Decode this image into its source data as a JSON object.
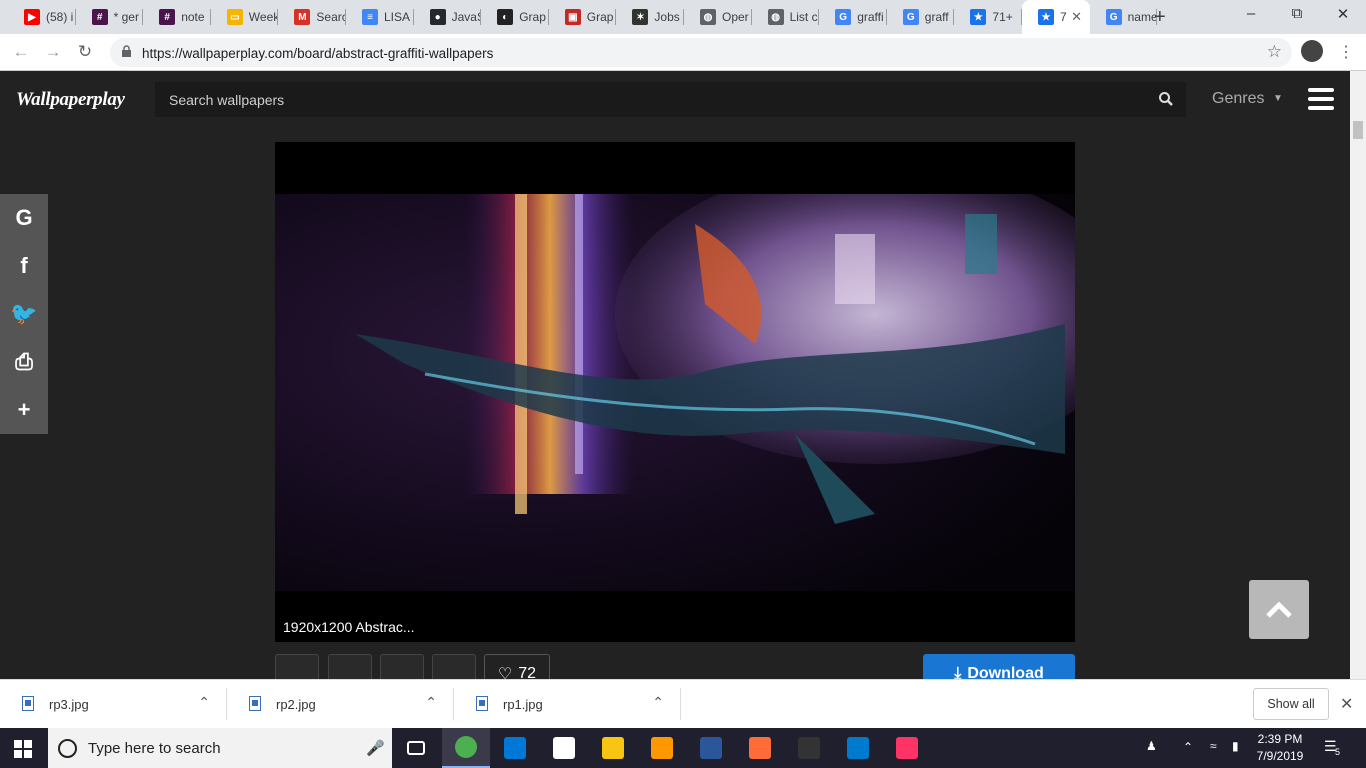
{
  "browser": {
    "tabs": [
      {
        "label": "(58) i",
        "icon": "youtube-icon",
        "color": "#ff0000",
        "glyph": "▶"
      },
      {
        "label": "* ger",
        "icon": "slack-icon",
        "color": "#4a154b",
        "glyph": "#"
      },
      {
        "label": "note",
        "icon": "slack-icon",
        "color": "#4a154b",
        "glyph": "#"
      },
      {
        "label": "Week",
        "icon": "google-slides-icon",
        "color": "#f4b400",
        "glyph": "▭"
      },
      {
        "label": "Searc",
        "icon": "gmail-icon",
        "color": "#d93025",
        "glyph": "M"
      },
      {
        "label": "LISA",
        "icon": "google-docs-icon",
        "color": "#4285f4",
        "glyph": "≡"
      },
      {
        "label": "JavaS",
        "icon": "github-icon",
        "color": "#24292e",
        "glyph": "●"
      },
      {
        "label": "Grap",
        "icon": "app-icon",
        "color": "#222222",
        "glyph": "◐"
      },
      {
        "label": "Grap",
        "icon": "app-icon",
        "color": "#c62828",
        "glyph": "▣"
      },
      {
        "label": "Jobs",
        "icon": "jobs-icon",
        "color": "#333333",
        "glyph": "✶"
      },
      {
        "label": "Oper",
        "icon": "globe-icon",
        "color": "#5f6368",
        "glyph": "◍"
      },
      {
        "label": "List c",
        "icon": "globe-icon",
        "color": "#5f6368",
        "glyph": "◍"
      },
      {
        "label": "graffi",
        "icon": "google-icon",
        "color": "#4285f4",
        "glyph": "G"
      },
      {
        "label": "graff",
        "icon": "google-icon",
        "color": "#4285f4",
        "glyph": "G"
      },
      {
        "label": "71+",
        "icon": "star-favicon-icon",
        "color": "#1a73e8",
        "glyph": "★"
      },
      {
        "label": "7",
        "icon": "star-favicon-icon",
        "color": "#1a73e8",
        "glyph": "★"
      },
      {
        "label": "name",
        "icon": "google-icon",
        "color": "#4285f4",
        "glyph": "G"
      }
    ],
    "url": "https://wallpaperplay.com/board/abstract-graffiti-wallpapers"
  },
  "site": {
    "logo": "Wallpaperplay",
    "search_placeholder": "Search wallpapers",
    "genres_label": "Genres",
    "caption": "1920x1200 Abstrac...",
    "likes": "72",
    "download_label": "Download",
    "share": [
      {
        "name": "google-share-icon",
        "glyph": "G"
      },
      {
        "name": "facebook-share-icon",
        "glyph": "f"
      },
      {
        "name": "twitter-share-icon",
        "glyph": "🐦"
      },
      {
        "name": "print-icon",
        "glyph": "⎙"
      },
      {
        "name": "more-share-icon",
        "glyph": "+"
      }
    ]
  },
  "downloads": {
    "files": [
      "rp3.jpg",
      "rp2.jpg",
      "rp1.jpg"
    ],
    "show_all": "Show all"
  },
  "taskbar": {
    "search_text": "Type here to search",
    "time": "2:39 PM",
    "date": "7/9/2019",
    "notifications": "5",
    "apps": [
      {
        "name": "task-view-icon",
        "color": "#ffffff"
      },
      {
        "name": "chrome-icon",
        "color": "#4caf50"
      },
      {
        "name": "store-icon",
        "color": "#0078d7"
      },
      {
        "name": "mail-icon",
        "color": "#ffffff"
      },
      {
        "name": "file-explorer-icon",
        "color": "#f9c513"
      },
      {
        "name": "sublime-icon",
        "color": "#ff9800"
      },
      {
        "name": "word-icon",
        "color": "#2b579a"
      },
      {
        "name": "postman-icon",
        "color": "#ff6c37"
      },
      {
        "name": "terminal-icon",
        "color": "#333333"
      },
      {
        "name": "vscode-icon",
        "color": "#007acc"
      },
      {
        "name": "indesign-icon",
        "color": "#ff3366"
      }
    ]
  }
}
